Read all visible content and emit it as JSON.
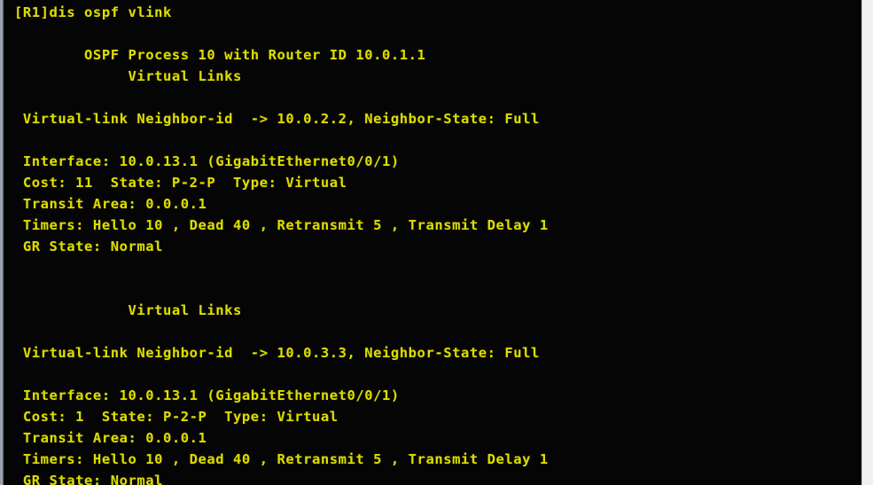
{
  "window": {
    "app_kind": "terminal-console",
    "background_color": "#050505",
    "text_color": "#dcdc00",
    "chrome_color": "#aab2bd",
    "page_color": "#efeff0"
  },
  "terminal": {
    "prompt_line": "[R1]dis ospf vlink",
    "command": "dis ospf vlink",
    "prompt": "[R1]",
    "process_header": "        OSPF Process 10 with Router ID 10.0.1.1",
    "process_id": "10",
    "router_id": "10.0.1.1",
    "lines": [
      "[R1]dis ospf vlink",
      "",
      "        OSPF Process 10 with Router ID 10.0.1.1",
      "             Virtual Links",
      "",
      " Virtual-link Neighbor-id  -> 10.0.2.2, Neighbor-State: Full",
      "",
      " Interface: 10.0.13.1 (GigabitEthernet0/0/1)",
      " Cost: 11  State: P-2-P  Type: Virtual",
      " Transit Area: 0.0.0.1",
      " Timers: Hello 10 , Dead 40 , Retransmit 5 , Transmit Delay 1",
      " GR State: Normal",
      "",
      "",
      "             Virtual Links",
      "",
      " Virtual-link Neighbor-id  -> 10.0.3.3, Neighbor-State: Full",
      "",
      " Interface: 10.0.13.1 (GigabitEthernet0/0/1)",
      " Cost: 1  State: P-2-P  Type: Virtual",
      " Transit Area: 0.0.0.1",
      " Timers: Hello 10 , Dead 40 , Retransmit 5 , Transmit Delay 1",
      " GR State: Normal"
    ],
    "virtual_links": [
      {
        "section_title": "Virtual Links",
        "neighbor_id": "10.0.2.2",
        "neighbor_state": "Full",
        "interface_ip": "10.0.13.1",
        "interface_name": "GigabitEthernet0/0/1",
        "cost": "11",
        "state": "P-2-P",
        "type": "Virtual",
        "transit_area": "0.0.0.1",
        "hello": "10",
        "dead": "40",
        "retransmit": "5",
        "transmit_delay": "1",
        "gr_state": "Normal"
      },
      {
        "section_title": "Virtual Links",
        "neighbor_id": "10.0.3.3",
        "neighbor_state": "Full",
        "interface_ip": "10.0.13.1",
        "interface_name": "GigabitEthernet0/0/1",
        "cost": "1",
        "state": "P-2-P",
        "type": "Virtual",
        "transit_area": "0.0.0.1",
        "hello": "10",
        "dead": "40",
        "retransmit": "5",
        "transmit_delay": "1",
        "gr_state": "Normal"
      }
    ]
  }
}
